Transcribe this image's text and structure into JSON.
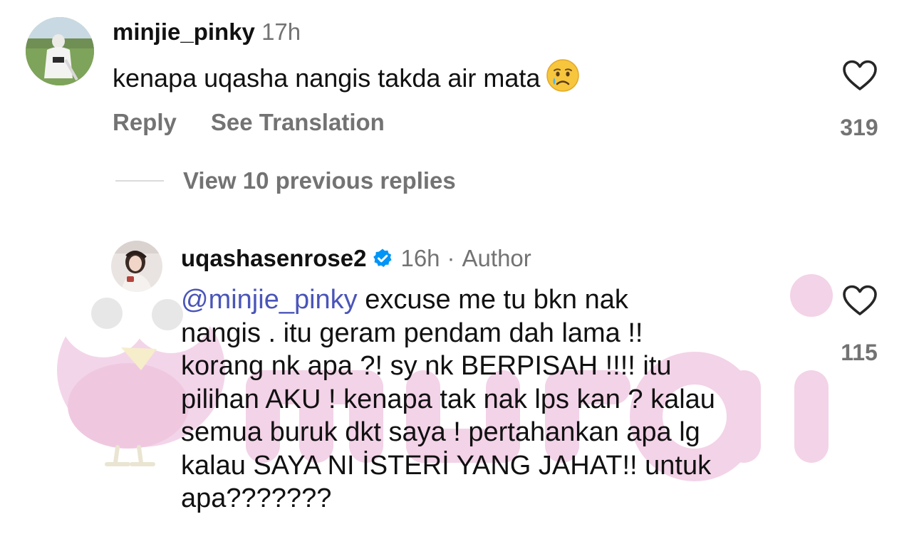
{
  "comment_1": {
    "username": "minjie_pinky",
    "time": "17h",
    "text": "kenapa uqasha nangis takda air mata",
    "emoji": "crying-face",
    "reply_label": "Reply",
    "translate_label": "See Translation",
    "likes": "319"
  },
  "view_replies_label": "View 10 previous replies",
  "comment_2": {
    "username": "uqashasenrose2",
    "time": "16h",
    "separator": "·",
    "author_label": "Author",
    "mention": "@minjie_pinky",
    "lines": [
      " excuse me tu bkn nak",
      "nangis . itu geram pendam dah lama !!",
      "korang nk apa ?! sy nk BERPISAH !!!! itu",
      "pilihan AKU ! kenapa tak nak lps kan ? kalau",
      "semua buruk dkt saya ! pertahankan apa lg",
      "kalau SAYA NI İSTERİ YANG JAHAT!! untuk",
      "apa???????"
    ],
    "likes": "115"
  },
  "watermark": "murai",
  "colors": {
    "secondary_text": "#737373",
    "mention": "#4a55b8",
    "verified": "#0095f6",
    "watermark": "#f3d3e8"
  }
}
